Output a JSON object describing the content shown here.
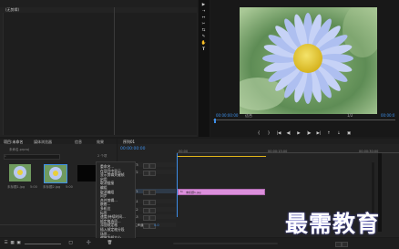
{
  "source_panel": {
    "tab_label": "(无剪辑)"
  },
  "tools": [
    "selection-icon",
    "track-select-icon",
    "ripple-edit-icon",
    "razor-icon",
    "slip-icon",
    "pen-icon",
    "hand-icon",
    "type-icon"
  ],
  "program_monitor": {
    "timecode": "00:00:00:00",
    "fit": "适合",
    "quality": "1/2",
    "duration": "00:00:0",
    "controls": [
      "mark-in-icon",
      "mark-out-icon",
      "go-to-in-icon",
      "step-back-icon",
      "play-icon",
      "step-forward-icon",
      "go-to-out-icon",
      "lift-icon",
      "extract-icon",
      "export-frame-icon"
    ]
  },
  "project_panel": {
    "tabs": [
      "项目:未命名",
      "媒体浏览器",
      "信息",
      "效果"
    ],
    "path": "未命名.prproj",
    "count": "2 个项",
    "items": [
      {
        "name": "未标题1.jpg",
        "dur": "5:00"
      },
      {
        "name": "未标题2.jpg",
        "dur": "5:00"
      }
    ]
  },
  "context_menu": {
    "items": [
      "重命名...",
      "在项目中显示",
      "显示剪辑关键帧",
      "启用",
      "取消链接",
      "编组",
      "取消编组",
      "同步",
      "合并剪辑...",
      "嵌套...",
      "多机位",
      "标签",
      "速度/持续时间...",
      "帧定格选项...",
      "添加帧定格",
      "插入帧定格分段",
      "场序...",
      "缩放为帧大小",
      "设为帧大小"
    ]
  },
  "timeline": {
    "tab_label": "序列01",
    "timecode": "00:00:00:00",
    "ruler": [
      "00:00",
      "00:00:15:00",
      "00:00:30:00"
    ],
    "tracks": [
      "V3",
      "V2",
      "V1",
      "A1",
      "A2",
      "A3",
      "主声道"
    ],
    "clip_label": "未标题1.jpg",
    "master_value": "0.0"
  },
  "watermark": "最需教育",
  "colors": {
    "clip": "#dc8fdc",
    "accent": "#3d8ee8",
    "playhead_bar": "#e0b41a"
  }
}
